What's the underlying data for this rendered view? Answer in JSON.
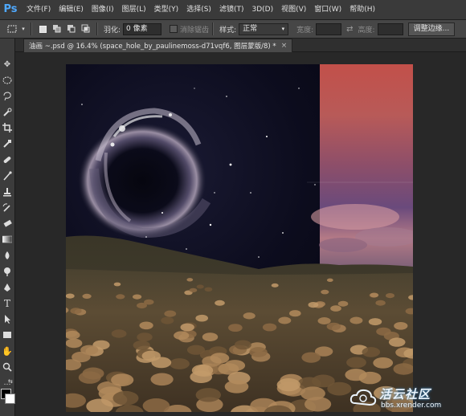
{
  "app": {
    "logo": "Ps"
  },
  "menu": [
    "文件(F)",
    "编辑(E)",
    "图像(I)",
    "图层(L)",
    "类型(Y)",
    "选择(S)",
    "滤镜(T)",
    "3D(D)",
    "视图(V)",
    "窗口(W)",
    "帮助(H)"
  ],
  "options": {
    "feather_label": "羽化:",
    "feather_value": "0 像素",
    "antialias_label": "消除锯齿",
    "style_label": "样式:",
    "style_value": "正常",
    "width_label": "宽度:",
    "height_label": "高度:",
    "refine_button": "调整边缘..."
  },
  "document": {
    "tab_title": "油画 ~.psd @ 16.4% (space_hole_by_paulinemoss-d71vqf6, 图层蒙版/8) *",
    "close_glyph": "×"
  },
  "colors": {
    "foreground": "#000000",
    "background": "#ffffff",
    "accent": "#4fa9ff"
  },
  "watermark": {
    "name": "活云社区",
    "url": "bbs.xrender.com"
  }
}
